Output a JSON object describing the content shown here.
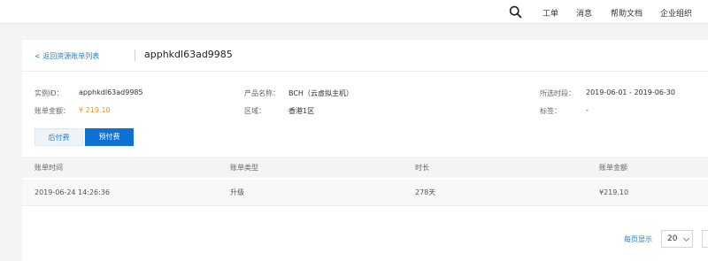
{
  "nav": {
    "items": [
      {
        "label": "工单"
      },
      {
        "label": "消息"
      },
      {
        "label": "帮助文档"
      },
      {
        "label": "企业组织"
      }
    ]
  },
  "header": {
    "back_link": "< 返回资源账单列表",
    "title": "apphkdl63ad9985"
  },
  "details": {
    "instance_id": {
      "label": "实例ID：",
      "value": "apphkdl63ad9985"
    },
    "bill_amount": {
      "label": "账单金额：",
      "value": "¥ 219.10"
    },
    "product_name": {
      "label": "产品名称：",
      "value": "BCH（云虚拟主机）"
    },
    "region": {
      "label": "区域：",
      "value": "香港1区"
    },
    "period": {
      "label": "所选时段：",
      "value": "2019-06-01 - 2019-06-30"
    },
    "tag": {
      "label": "标签：",
      "value": "-"
    }
  },
  "tabs": {
    "postpaid": "后付费",
    "prepaid": "预付费",
    "active": "prepaid"
  },
  "table": {
    "columns": [
      "账单时间",
      "账单类型",
      "时长",
      "账单金额"
    ],
    "rows": [
      [
        "2019-06-24 14:26:36",
        "升级",
        "278天",
        "¥219.10"
      ]
    ]
  },
  "pager": {
    "label": "每页显示",
    "page_size": "20"
  },
  "colors": {
    "accent": "#0e6fd4",
    "link": "#1e7fd6",
    "amount": "#f0942a"
  }
}
